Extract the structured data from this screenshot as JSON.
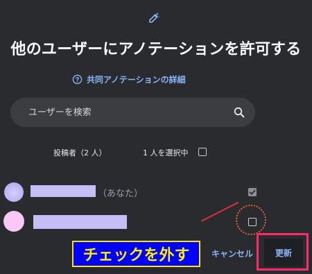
{
  "dialog": {
    "top_icon": "edit-pencil-sparkle-icon",
    "title": "他のユーザーにアノテーションを許可する",
    "details_link": {
      "icon": "help-circle-icon",
      "label": "共同アノテーションの詳細"
    },
    "search": {
      "placeholder": "ユーザーを検索",
      "value": "",
      "icon": "search-icon"
    },
    "list_header": {
      "posters_label": "投稿者（2 人）",
      "selected_label": "1 人を選択中",
      "select_all_checked": false
    },
    "users": [
      {
        "you_label": "（あなた）",
        "checked": true,
        "checkbox_disabled": true
      },
      {
        "you_label": "",
        "checked": false,
        "checkbox_disabled": false
      }
    ],
    "actions": {
      "cancel_label": "キャンセル",
      "update_label": "更新"
    }
  },
  "annotations": {
    "callout_text": "チェックを外す"
  },
  "colors": {
    "background": "#2a2b2e",
    "accent": "#8ab4f8",
    "name_redaction": "#c5bdf5",
    "callout_bg": "#0000ff",
    "callout_text": "#ffee00",
    "highlight_border": "#ff2a6a"
  }
}
